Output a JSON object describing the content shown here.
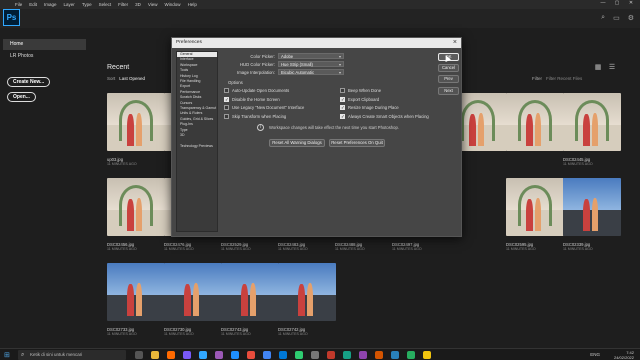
{
  "app": {
    "logo": "Ps",
    "menu": [
      "File",
      "Edit",
      "Image",
      "Layer",
      "Type",
      "Select",
      "Filter",
      "3D",
      "View",
      "Window",
      "Help"
    ],
    "window_controls": [
      "—",
      "▢",
      "✕"
    ]
  },
  "topbar": {
    "icons": [
      "search-icon",
      "layout-icon",
      "settings-icon"
    ]
  },
  "sidebar": {
    "items": [
      "Home",
      "LR Photos"
    ],
    "create_label": "Create New...",
    "open_label": "Open..."
  },
  "recent": {
    "title": "Recent",
    "sort_label": "Sort",
    "sort_value": "Last Opened",
    "filter_label": "Filter",
    "filter_placeholder": "Filter Recent Files"
  },
  "files": [
    {
      "name": "up03.jpg",
      "time": "11 MINUTES AGO",
      "kind": "wed"
    },
    {
      "name": "",
      "time": "",
      "kind": "wed"
    },
    {
      "name": "",
      "time": "",
      "kind": "wed"
    },
    {
      "name": "",
      "time": "",
      "kind": "wed"
    },
    {
      "name": "",
      "time": "",
      "kind": "wed"
    },
    {
      "name": "",
      "time": "",
      "kind": "wed"
    },
    {
      "name": "",
      "time": "",
      "kind": "wed"
    },
    {
      "name": "DSC02445.jpg",
      "time": "11 MINUTES AGO",
      "kind": "wed"
    },
    {
      "name": "DSC02456.jpg",
      "time": "11 MINUTES AGO",
      "kind": "wed"
    },
    {
      "name": "DSC02476.jpg",
      "time": "11 MINUTES AGO",
      "kind": "wed"
    },
    {
      "name": "DSC02529.jpg",
      "time": "11 MINUTES AGO",
      "kind": "wed"
    },
    {
      "name": "DSC02483.jpg",
      "time": "11 MINUTES AGO",
      "kind": "wed"
    },
    {
      "name": "DSC02488.jpg",
      "time": "11 MINUTES AGO",
      "kind": "wed"
    },
    {
      "name": "DSC02497.jpg",
      "time": "11 MINUTES AGO",
      "kind": "wed"
    },
    {
      "name": "DSC02595.jpg",
      "time": "11 MINUTES AGO",
      "kind": "wed"
    },
    {
      "name": "DSC02339.jpg",
      "time": "11 MINUTES AGO",
      "kind": "blue"
    },
    {
      "name": "DSC02733.jpg",
      "time": "11 MINUTES AGO",
      "kind": "blue"
    },
    {
      "name": "DSC02730.jpg",
      "time": "11 MINUTES AGO",
      "kind": "blue"
    },
    {
      "name": "DSC02743.jpg",
      "time": "11 MINUTES AGO",
      "kind": "blue"
    },
    {
      "name": "DSC02742.jpg",
      "time": "11 MINUTES AGO",
      "kind": "blue"
    }
  ],
  "dialog": {
    "title": "Preferences",
    "nav": [
      "General",
      "Interface",
      "Workspace",
      "Tools",
      "History Log",
      "File Handling",
      "Export",
      "Performance",
      "Scratch Disks",
      "Cursors",
      "Transparency & Gamut",
      "Units & Rulers",
      "Guides, Grid & Slices",
      "Plug-Ins",
      "Type",
      "3D",
      "",
      "Technology Previews"
    ],
    "color_picker_label": "Color Picker:",
    "color_picker_value": "Adobe",
    "hud_label": "HUD Color Picker:",
    "hud_value": "Hue Strip (Small)",
    "interp_label": "Image Interpolation:",
    "interp_value": "Bicubic Automatic",
    "options_title": "Options",
    "left_options": [
      {
        "label": "Auto-Update Open Documents",
        "checked": false
      },
      {
        "label": "Disable the Home Screen",
        "checked": true
      },
      {
        "label": "Use Legacy \"New Document\" Interface",
        "checked": false
      },
      {
        "label": "Skip Transform when Placing",
        "checked": false
      }
    ],
    "right_options": [
      {
        "label": "Beep When Done",
        "checked": false
      },
      {
        "label": "Export Clipboard",
        "checked": true
      },
      {
        "label": "Resize Image During Place",
        "checked": true
      },
      {
        "label": "Always Create Smart Objects when Placing",
        "checked": true
      }
    ],
    "info_text": "Workspace changes will take effect the next time you start Photoshop.",
    "reset_warnings": "Reset All Warning Dialogs",
    "reset_prefs": "Reset Preferences On Quit",
    "buttons": {
      "ok": "OK",
      "cancel": "Cancel",
      "prev": "Prev",
      "next": "Next"
    }
  },
  "taskbar": {
    "search_placeholder": "Ketik di sini untuk mencari",
    "lang": "ENG",
    "time": "7:42",
    "date": "24/02/2022"
  }
}
